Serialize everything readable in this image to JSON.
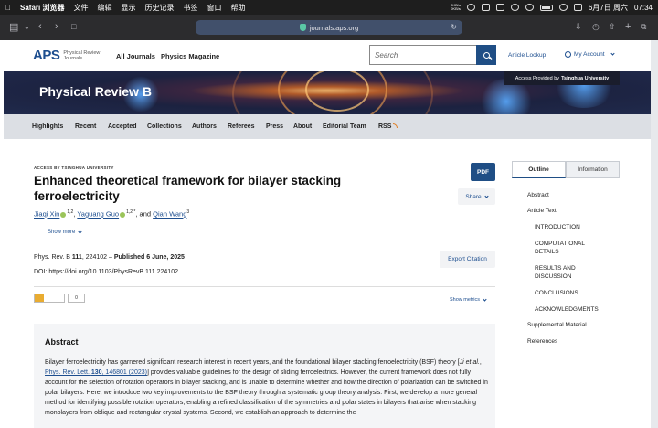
{
  "menubar": {
    "apple": "",
    "app": "Safari 浏览器",
    "items": [
      "文件",
      "编辑",
      "显示",
      "历史记录",
      "书签",
      "窗口",
      "帮助"
    ],
    "status_top": "0KB/s",
    "status_bottom": "0KB/s",
    "date": "6月7日 周六",
    "time": "07:34"
  },
  "browser": {
    "url": "journals.aps.org"
  },
  "site": {
    "logo_text": "APS",
    "logo_sub_1": "Physical Review",
    "logo_sub_2": "Journals",
    "nav": [
      "All Journals",
      "Physics Magazine"
    ],
    "search_placeholder": "Search",
    "article_lookup": "Article Lookup",
    "my_account": "My Account"
  },
  "banner": {
    "journal": "Physical Review B",
    "access_prefix": "Access Provided by",
    "access_institution": "Tsinghua University"
  },
  "subnav": [
    "Highlights",
    "Recent",
    "Accepted",
    "Collections",
    "Authors",
    "Referees",
    "Press",
    "About",
    "Editorial Team",
    "RSS"
  ],
  "article": {
    "access_label": "ACCESS BY TSINGHUA UNIVERSITY",
    "title": "Enhanced theoretical framework for bilayer stacking ferroelectricity",
    "authors": [
      {
        "name": "Jiaqi Xin",
        "sup": "1,2"
      },
      {
        "name": "Yaguang Guo",
        "sup": "1,2,*"
      },
      {
        "name": "Qian Wang",
        "sup": "3"
      }
    ],
    "author_sep": ", ",
    "author_and": ", and ",
    "show_more": "Show more",
    "journal_ref": "Phys. Rev. B",
    "volume": "111",
    "article_no": ", 224102 – ",
    "published": "Published 6 June, 2025",
    "doi": "DOI: https://doi.org/10.1103/PhysRevB.111.224102",
    "pdf": "PDF",
    "share": "Share",
    "export_citation": "Export Citation",
    "altmetric_count": "0",
    "show_metrics": "Show metrics"
  },
  "abstract": {
    "heading": "Abstract",
    "text_1": "Bilayer ferroelectricity has garnered significant research interest in recent years, and the foundational bilayer stacking ferroelectricity (BSF) theory [",
    "ref_authors": "Ji et al.",
    "ref_sep": ", ",
    "ref_link_1": "Phys. Rev. Lett. ",
    "ref_link_vol": "130",
    "ref_link_2": ", 146801 (2023)",
    "text_2": "] provides valuable guidelines for the design of sliding ferroelectrics. However, the current framework does not fully account for the selection of rotation operators in bilayer stacking, and is unable to determine whether and how the direction of polarization can be switched in polar bilayers. Here, we introduce two key improvements to the BSF theory through a systematic group theory analysis. First, we develop a more general method for identifying possible rotation operators, enabling a refined classification of the symmetries and polar states in bilayers that arise when stacking monolayers from oblique and rectangular crystal systems. Second, we establish an approach to determine the"
  },
  "sidebar": {
    "tabs": [
      "Outline",
      "Information"
    ],
    "outline": [
      "Abstract",
      "Article Text",
      "INTRODUCTION",
      "COMPUTATIONAL DETAILS",
      "RESULTS AND DISCUSSION",
      "CONCLUSIONS",
      "ACKNOWLEDGMENTS",
      "Supplemental Material",
      "References"
    ]
  }
}
